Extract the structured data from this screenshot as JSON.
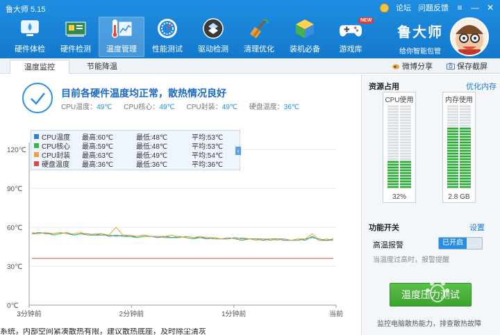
{
  "window": {
    "title": "鲁大师 5.15",
    "links": [
      "论坛",
      "问题反馈"
    ],
    "controls": [
      "≡",
      "—",
      "✕"
    ]
  },
  "nav": [
    {
      "label": "硬件体检",
      "icon": "hardware-check-icon"
    },
    {
      "label": "硬件检测",
      "icon": "hardware-detect-icon"
    },
    {
      "label": "温度管理",
      "icon": "thermometer-icon"
    },
    {
      "label": "性能测试",
      "icon": "speedometer-icon"
    },
    {
      "label": "驱动检测",
      "icon": "driver-icon"
    },
    {
      "label": "清理优化",
      "icon": "broom-icon"
    },
    {
      "label": "装机必备",
      "icon": "box-icon"
    },
    {
      "label": "游戏库",
      "icon": "gamepad-icon",
      "badge": "NEW"
    }
  ],
  "brand": {
    "name": "鲁大师",
    "slogan": "给你智能包管"
  },
  "tabs": [
    "温度监控",
    "节能降温"
  ],
  "tabbar_actions": [
    "微博分享",
    "保存截屏"
  ],
  "status": {
    "title": "目前各硬件温度均正常，散热情况良好",
    "readings": [
      {
        "label": "CPU温度：",
        "value": "49℃"
      },
      {
        "label": "CPU核心：",
        "value": "49℃"
      },
      {
        "label": "CPU封装：",
        "value": "49℃"
      },
      {
        "label": "硬盘温度：",
        "value": "36℃"
      }
    ]
  },
  "legend": [
    {
      "name": "CPU温度",
      "max": "最高:60℃",
      "min": "最低:48℃",
      "avg": "平均:53℃",
      "color": "#2f7fd8"
    },
    {
      "name": "CPU核心",
      "max": "最高:59℃",
      "min": "最低:48℃",
      "avg": "平均:53℃",
      "color": "#39b54a"
    },
    {
      "name": "CPU封装",
      "max": "最高:63℃",
      "min": "最低:49℃",
      "avg": "平均:54℃",
      "color": "#f0a030"
    },
    {
      "name": "硬盘温度",
      "max": "最高:36℃",
      "min": "最低:36℃",
      "avg": "平均:36℃",
      "color": "#e04848"
    }
  ],
  "chart_data": {
    "type": "line",
    "y_ticks": [
      "120℃",
      "90℃",
      "60℃",
      "30℃",
      "0℃"
    ],
    "x_ticks": [
      "3分钟前",
      "2分钟前",
      "1分钟前",
      "当前"
    ],
    "ylim": [
      0,
      120
    ],
    "series": [
      {
        "name": "CPU温度",
        "color": "#2f7fd8",
        "values": [
          55,
          56,
          55,
          55,
          56,
          55,
          54,
          55,
          54,
          54,
          55,
          53,
          54,
          53,
          53,
          53,
          54,
          53,
          52,
          53,
          52,
          52,
          53,
          52,
          52,
          51,
          52,
          51,
          51,
          52,
          51,
          51,
          51,
          50,
          51,
          51,
          50,
          50,
          51,
          50,
          53,
          50,
          50,
          51
        ]
      },
      {
        "name": "CPU核心",
        "color": "#39b54a",
        "values": [
          55,
          55,
          56,
          54,
          55,
          56,
          54,
          55,
          55,
          54,
          54,
          54,
          53,
          54,
          53,
          52,
          53,
          53,
          53,
          52,
          52,
          53,
          52,
          51,
          52,
          52,
          51,
          51,
          52,
          51,
          50,
          51,
          51,
          51,
          50,
          51,
          51,
          50,
          50,
          51,
          52,
          51,
          50,
          50
        ]
      },
      {
        "name": "CPU封装",
        "color": "#f0a030",
        "values": [
          56,
          55,
          56,
          55,
          56,
          55,
          55,
          56,
          54,
          55,
          55,
          54,
          60,
          54,
          54,
          53,
          54,
          53,
          53,
          53,
          54,
          52,
          53,
          52,
          53,
          52,
          52,
          51,
          52,
          51,
          52,
          51,
          50,
          51,
          51,
          50,
          51,
          50,
          51,
          51,
          55,
          50,
          51,
          50
        ]
      },
      {
        "name": "硬盘温度",
        "color": "#e04848",
        "values": [
          36,
          36,
          36,
          36,
          36,
          36,
          36,
          36,
          36,
          36,
          36,
          36,
          36,
          36,
          36,
          36,
          36,
          36,
          36,
          36,
          36,
          36,
          36,
          36,
          36,
          36,
          36,
          36,
          36,
          36,
          36,
          36,
          36,
          36,
          36,
          36,
          36,
          36,
          36,
          36,
          36,
          36,
          36,
          36
        ]
      }
    ]
  },
  "resource": {
    "title": "资源占用",
    "optimize_link": "优化内存",
    "cpu": {
      "label": "CPU使用",
      "value": "32%",
      "fraction": 0.32
    },
    "memory": {
      "label": "内存使用",
      "value": "2.8 GB",
      "fraction": 0.72
    }
  },
  "features": {
    "title": "功能开关",
    "settings_link": "设置",
    "alarm_label": "高温报警",
    "alarm_state": "已开启",
    "alarm_desc": "当温度过高时，报警提醒",
    "test_button": "温度压力测试",
    "test_desc": "监控电脑散热能力，排查散热故障"
  },
  "bottom_text": "系统，内部空间紧凑散热有限，建议散热底座，及时除尘清灰"
}
